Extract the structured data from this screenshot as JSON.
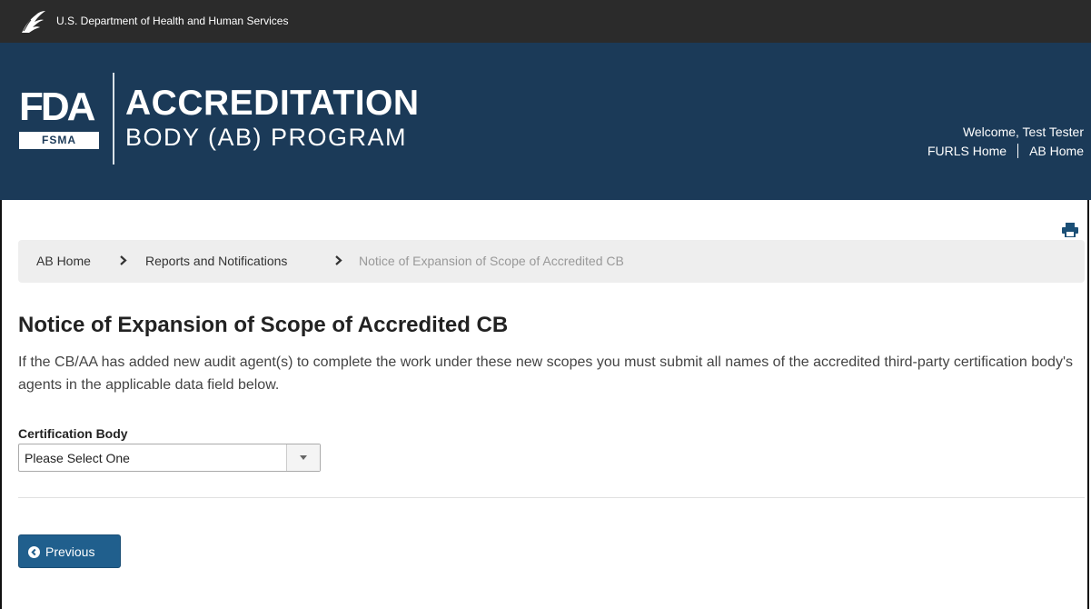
{
  "top_bar": {
    "agency": "U.S. Department of Health and Human Services"
  },
  "banner": {
    "fda_logo": "FDA",
    "fsma_label": "FSMA",
    "program_line1": "ACCREDITATION",
    "program_line2": "BODY (AB) PROGRAM",
    "welcome": "Welcome, Test Tester",
    "links": {
      "furls_home": "FURLS Home",
      "ab_home": "AB Home"
    }
  },
  "breadcrumb": {
    "items": [
      "AB Home",
      "Reports and Notifications",
      "Notice of Expansion of Scope of Accredited CB"
    ]
  },
  "main": {
    "title": "Notice of Expansion of Scope of Accredited CB",
    "intro": "If the CB/AA has added new audit agent(s) to complete the work under these new scopes you must submit all names of the accredited third-party certification body's agents in the applicable data field below.",
    "certification_body": {
      "label": "Certification Body",
      "selected": "Please Select One"
    },
    "previous_button": "Previous"
  },
  "icons": {
    "hhs": "hhs-eagle-icon",
    "print": "print-icon",
    "chevron": "chevron-right-icon",
    "previous": "circle-arrow-left-icon",
    "dropdown": "caret-down-icon"
  },
  "colors": {
    "top_bar": "#2b2b2b",
    "banner": "#1b3a58",
    "button": "#205f8d",
    "breadcrumb_bg": "#eeeeee"
  }
}
